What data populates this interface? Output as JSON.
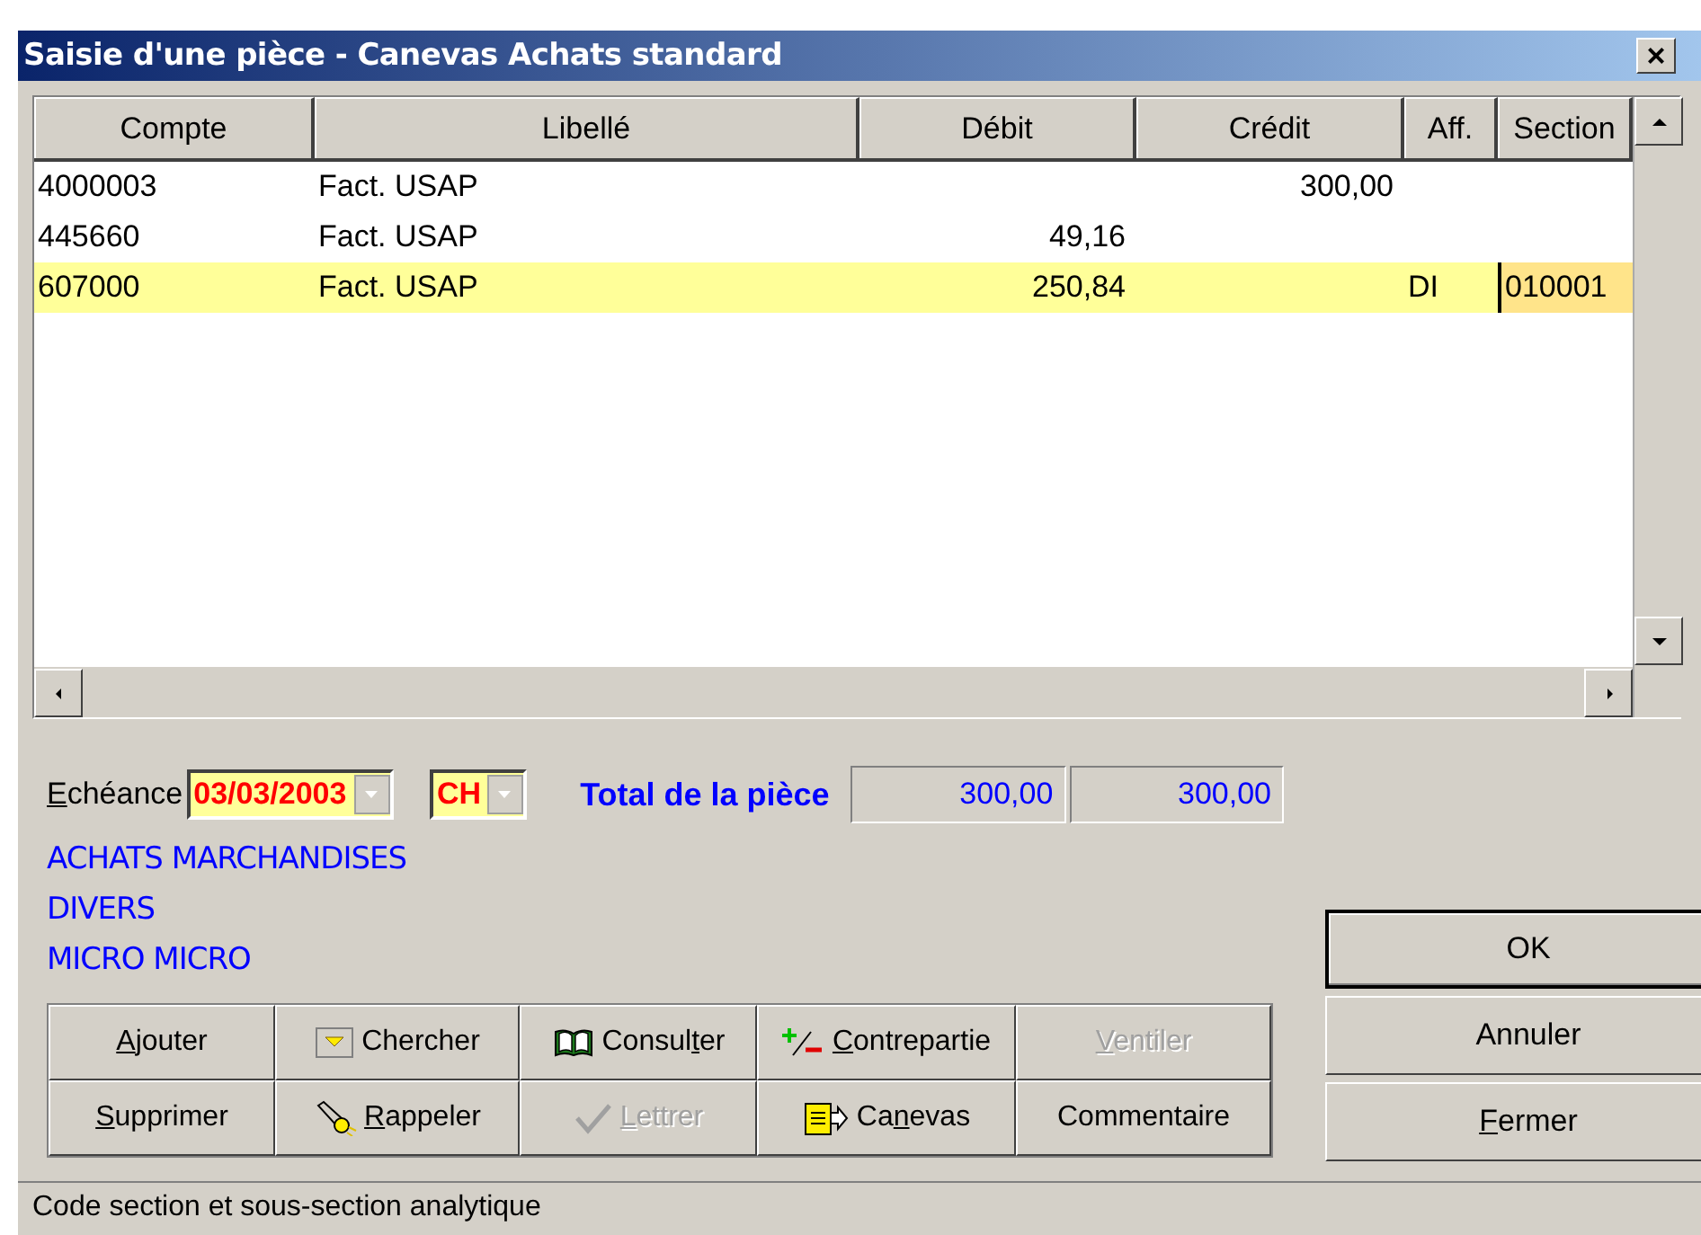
{
  "window": {
    "title": "Saisie d'une pièce - Canevas Achats standard",
    "close": "×"
  },
  "table": {
    "columns": [
      "Compte",
      "Libellé",
      "Débit",
      "Crédit",
      "Aff.",
      "Section"
    ],
    "rows": [
      {
        "compte": "4000003",
        "libelle": "Fact. USAP",
        "debit": "",
        "credit": "300,00",
        "aff": "",
        "section": "",
        "selected": false
      },
      {
        "compte": "445660",
        "libelle": "Fact. USAP",
        "debit": "49,16",
        "credit": "",
        "aff": "",
        "section": "",
        "selected": false
      },
      {
        "compte": "607000",
        "libelle": "Fact. USAP",
        "debit": "250,84",
        "credit": "",
        "aff": "DI",
        "section": "010001",
        "selected": true
      }
    ]
  },
  "echeance": {
    "label": "Echéance",
    "date": "03/03/2003",
    "mode": "CH"
  },
  "total": {
    "label": "Total de la pièce",
    "debit": "300,00",
    "credit": "300,00"
  },
  "info_lines": [
    "ACHATS MARCHANDISES",
    "DIVERS",
    "MICRO MICRO"
  ],
  "actions": [
    {
      "label": "Ajouter",
      "disabled": false
    },
    {
      "label": "Chercher",
      "disabled": false
    },
    {
      "label": "Consulter",
      "disabled": false
    },
    {
      "label": "Contrepartie",
      "disabled": false
    },
    {
      "label": "Ventiler",
      "disabled": true
    },
    {
      "label": "Supprimer",
      "disabled": false
    },
    {
      "label": "Rappeler",
      "disabled": false
    },
    {
      "label": "Lettrer",
      "disabled": true
    },
    {
      "label": "Canevas",
      "disabled": false
    },
    {
      "label": "Commentaire",
      "disabled": false
    }
  ],
  "dialog_buttons": [
    {
      "label": "OK",
      "default": true
    },
    {
      "label": "Annuler",
      "default": false
    },
    {
      "label": "Fermer",
      "default": false
    }
  ],
  "status_bar": "Code section et sous-section analytique"
}
